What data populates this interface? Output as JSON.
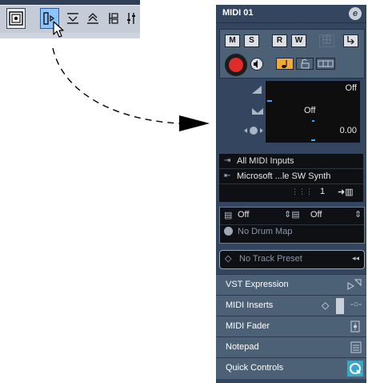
{
  "toolbar": {
    "tools": [
      {
        "icon": "inspector-toggle-icon"
      },
      {
        "icon": "show-inspector-icon",
        "selected": true
      },
      {
        "icon": "collapse-sections-icon"
      },
      {
        "icon": "expand-sections-icon"
      },
      {
        "icon": "setup-layout-icon"
      },
      {
        "icon": "mixer-channel-icon"
      }
    ]
  },
  "inspector": {
    "track_name": "MIDI 01",
    "edit_button": "e",
    "buttons": {
      "mute": "M",
      "solo": "S",
      "read": "R",
      "write": "W"
    },
    "params": [
      {
        "icon": "volume-icon",
        "value": "Off"
      },
      {
        "icon": "pan-icon",
        "value": "Off"
      },
      {
        "icon": "delay-icon",
        "value": "0.00"
      }
    ],
    "input": "All MIDI Inputs",
    "output": "Microsoft ...le SW Synth",
    "channel": "1",
    "bank": "Off",
    "program": "Off",
    "drum_map": "No Drum Map",
    "track_preset": "No Track Preset",
    "sections": [
      {
        "label": "VST Expression"
      },
      {
        "label": "MIDI Inserts"
      },
      {
        "label": "MIDI Fader"
      },
      {
        "label": "Notepad"
      },
      {
        "label": "Quick Controls"
      }
    ]
  },
  "colors": {
    "inspector_bg": "#34465f",
    "panel_bg": "#4c6076",
    "record_red": "#e02b2b",
    "selected_tool": "#8cc4ff",
    "quick_controls_accent": "#3aa8c4"
  }
}
